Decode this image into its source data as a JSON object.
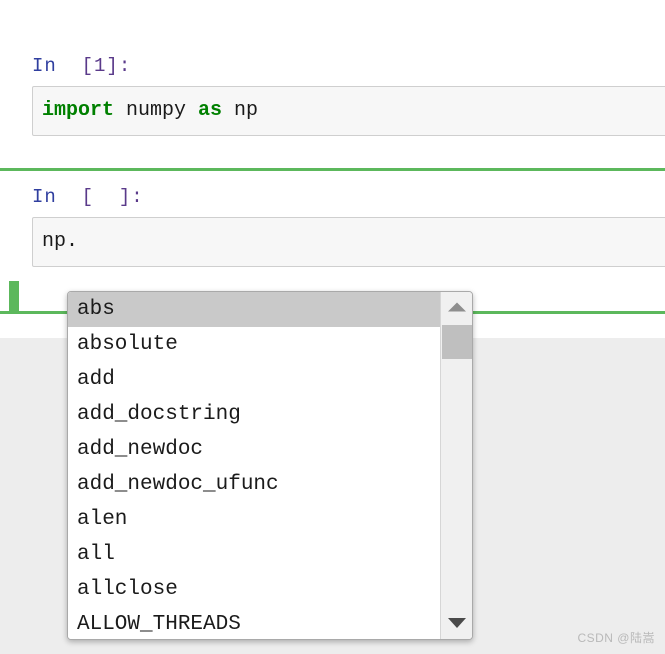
{
  "notebook": {
    "cells": [
      {
        "prompt_label": "In",
        "prompt_index": "[1]:",
        "execution_count": "1",
        "selected": false,
        "source_tokens": [
          {
            "text": "import",
            "kind": "keyword"
          },
          {
            "text": " numpy ",
            "kind": "plain"
          },
          {
            "text": "as",
            "kind": "keyword"
          },
          {
            "text": " np",
            "kind": "plain"
          }
        ],
        "source_text": "import numpy as np"
      },
      {
        "prompt_label": "In",
        "prompt_index": "[  ]:",
        "execution_count": "",
        "selected": true,
        "source_tokens": [
          {
            "text": "np.",
            "kind": "plain"
          }
        ],
        "source_text": "np."
      }
    ]
  },
  "completer": {
    "selected_index": 0,
    "items": [
      "abs",
      "absolute",
      "add",
      "add_docstring",
      "add_newdoc",
      "add_newdoc_ufunc",
      "alen",
      "all",
      "allclose",
      "ALLOW_THREADS"
    ],
    "scrollbar": {
      "up_arrow_icon": "chevron-up-icon",
      "down_arrow_icon": "chevron-down-icon",
      "thumb_position_percent": 9
    }
  },
  "watermark": {
    "text": "CSDN @陆嵩"
  },
  "colors": {
    "selected_cell_accent": "#5cb85c",
    "prompt_text": "#303F9F",
    "keyword": "#008000",
    "input_background": "#f7f7f7",
    "completer_highlight": "#c9c9c9",
    "page_background": "#ededed"
  }
}
